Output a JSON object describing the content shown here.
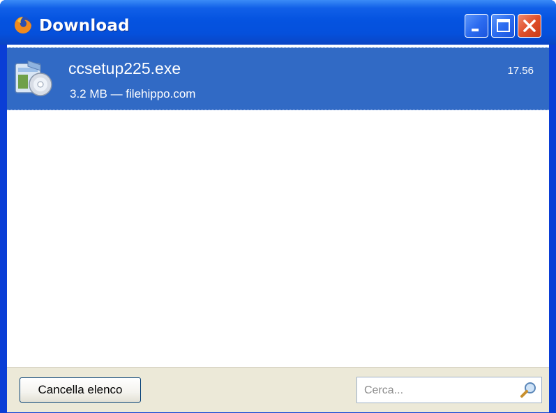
{
  "window": {
    "title": "Download",
    "icon": "firefox-icon",
    "controls": [
      "minimize-icon",
      "maximize-icon",
      "close-icon"
    ]
  },
  "downloads": [
    {
      "filename": "ccsetup225.exe",
      "meta": "3.2 MB — filehippo.com",
      "time": "17.56",
      "icon": "installer-icon"
    }
  ],
  "footer": {
    "clear_label": "Cancella elenco",
    "search_placeholder": "Cerca..."
  },
  "colors": {
    "titlebar": "#0553e0",
    "selection": "#316ac5",
    "footer_bg": "#ece9d8",
    "close_button": "#e0502b"
  }
}
